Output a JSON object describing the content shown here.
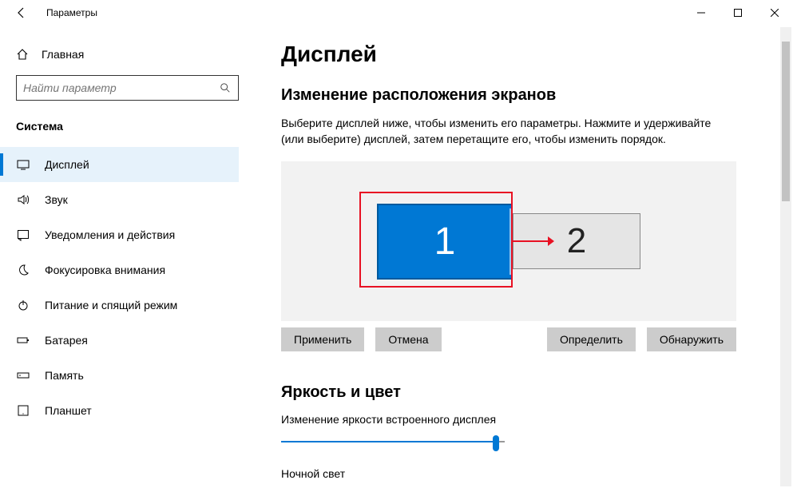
{
  "titlebar": {
    "title": "Параметры"
  },
  "sidebar": {
    "home": "Главная",
    "search_placeholder": "Найти параметр",
    "section": "Система",
    "items": [
      {
        "label": "Дисплей"
      },
      {
        "label": "Звук"
      },
      {
        "label": "Уведомления и действия"
      },
      {
        "label": "Фокусировка внимания"
      },
      {
        "label": "Питание и спящий режим"
      },
      {
        "label": "Батарея"
      },
      {
        "label": "Память"
      },
      {
        "label": "Планшет"
      }
    ]
  },
  "main": {
    "heading": "Дисплей",
    "arrange_title": "Изменение расположения экранов",
    "arrange_desc": "Выберите дисплей ниже, чтобы изменить его параметры. Нажмите и удерживайте (или выберите) дисплей, затем перетащите его, чтобы изменить порядок.",
    "monitor1": "1",
    "monitor2": "2",
    "apply": "Применить",
    "cancel": "Отмена",
    "identify": "Определить",
    "detect": "Обнаружить",
    "brightness_heading": "Яркость и цвет",
    "brightness_label": "Изменение яркости встроенного дисплея",
    "night_light": "Ночной свет"
  }
}
